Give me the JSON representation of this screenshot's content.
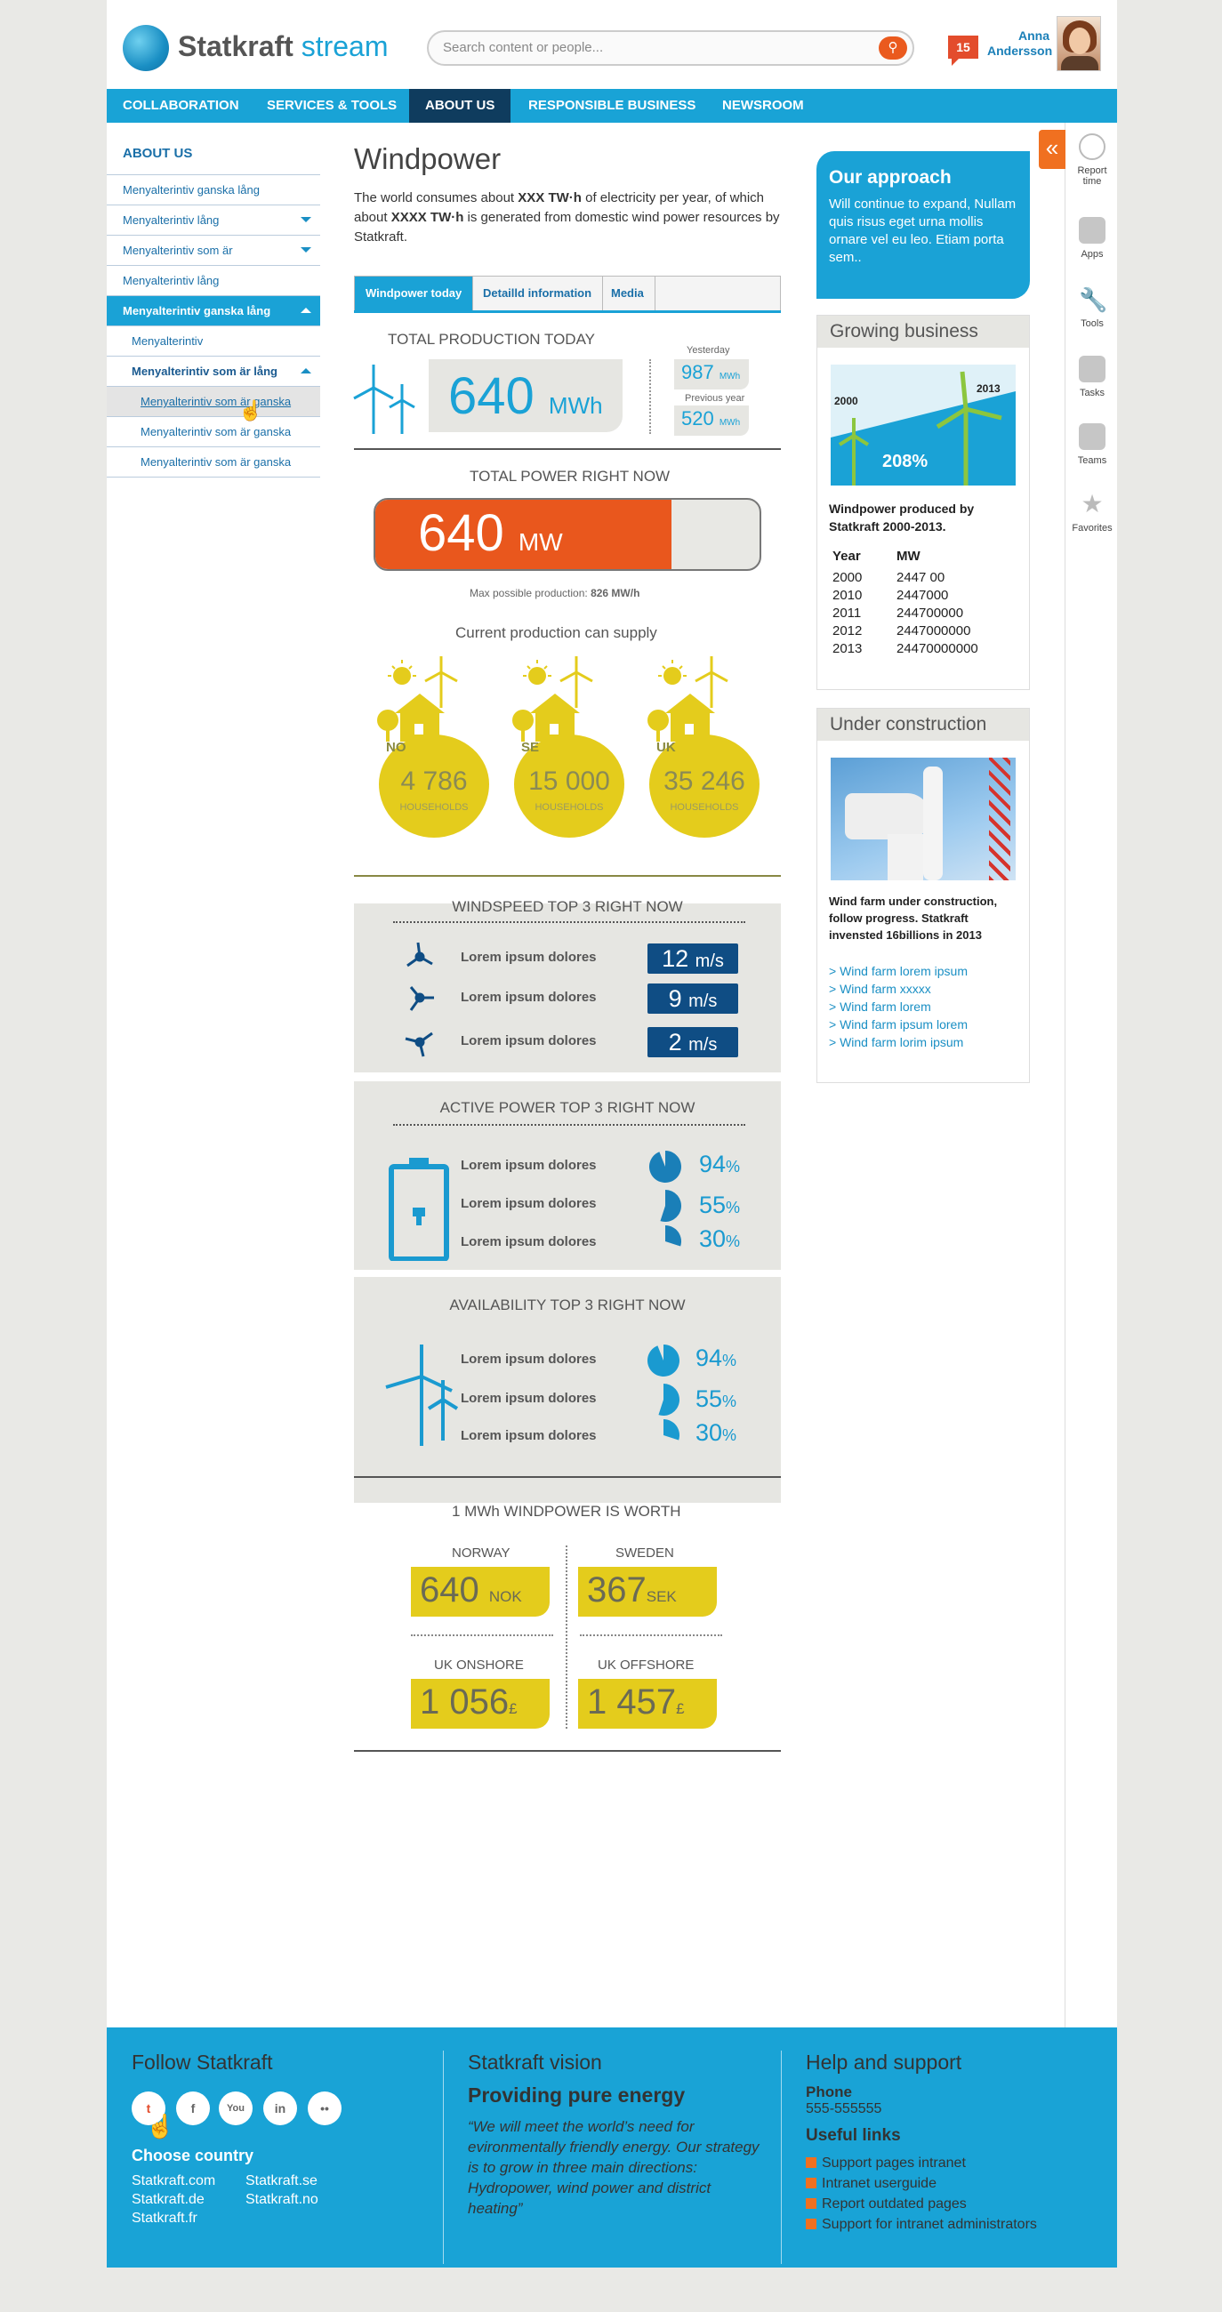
{
  "header": {
    "brand": "Statkraft",
    "brand_suffix": "stream",
    "search_placeholder": "Search content or people...",
    "notifications": "15",
    "user_first": "Anna",
    "user_last": "Andersson"
  },
  "nav": [
    "COLLABORATION",
    "SERVICES & TOOLS",
    "ABOUT US",
    "RESPONSIBLE BUSINESS",
    "NEWSROOM"
  ],
  "sidebar": {
    "title": "ABOUT US",
    "items": [
      "Menyalterintiv ganska lång",
      "Menyalterintiv  lång",
      "Menyalterintiv som är",
      "Menyalterintiv lång",
      "Menyalterintiv ganska lång",
      "Menyalterintiv",
      "Menyalterintiv som är lång",
      "Menyalterintiv som är ganska",
      "Menyalterintiv som är ganska",
      "Menyalterintiv som är ganska"
    ]
  },
  "righttools": [
    "Report time",
    "Apps",
    "Tools",
    "Tasks",
    "Teams",
    "Favorites"
  ],
  "main": {
    "title": "Windpower",
    "intro_1": "The world consumes about ",
    "intro_b1": "XXX TW·h",
    "intro_2": " of electricity per year, of which about ",
    "intro_b2": "XXXX TW·h",
    "intro_3": " is generated from domestic wind power resources by Statkraft.",
    "tabs": [
      "Windpower today",
      "Detailld information",
      "Media"
    ],
    "total_today": {
      "label": "TOTAL PRODUCTION TODAY",
      "value": "640",
      "unit": "MWh",
      "yesterday_label": "Yesterday",
      "yesterday_value": "987",
      "yesterday_unit": "MWh",
      "prev_label": "Previous year",
      "prev_value": "520",
      "prev_unit": "MWh"
    },
    "power_now": {
      "label": "TOTAL POWER RIGHT NOW",
      "value": "640",
      "unit": "MW",
      "fill_fraction": 0.77,
      "max_label": "Max possible production: ",
      "max_value": "826 MW/h"
    },
    "supply": {
      "label": "Current production can supply",
      "items": [
        {
          "cc": "NO",
          "value": "4 786",
          "unit": "HOUSEHOLDS"
        },
        {
          "cc": "SE",
          "value": "15 000",
          "unit": "HOUSEHOLDS"
        },
        {
          "cc": "UK",
          "value": "35 246",
          "unit": "HOUSEHOLDS"
        }
      ]
    },
    "windspeed": {
      "title": "WINDSPEED TOP 3 RIGHT NOW",
      "rows": [
        {
          "label": "Lorem ipsum dolores",
          "value": "12",
          "unit": "m/s"
        },
        {
          "label": "Lorem ipsum dolores",
          "value": "9",
          "unit": "m/s"
        },
        {
          "label": "Lorem ipsum dolores",
          "value": "2",
          "unit": "m/s"
        }
      ]
    },
    "active_power": {
      "title": "ACTIVE POWER TOP 3 RIGHT NOW",
      "rows": [
        {
          "label": "Lorem ipsum dolores",
          "value": "94",
          "unit": "%"
        },
        {
          "label": "Lorem ipsum dolores",
          "value": "55",
          "unit": "%"
        },
        {
          "label": "Lorem ipsum dolores",
          "value": "30",
          "unit": "%"
        }
      ]
    },
    "availability": {
      "title": "AVAILABILITY TOP 3 RIGHT NOW",
      "rows": [
        {
          "label": "Lorem ipsum dolores",
          "value": "94",
          "unit": "%"
        },
        {
          "label": "Lorem ipsum dolores",
          "value": "55",
          "unit": "%"
        },
        {
          "label": "Lorem ipsum dolores",
          "value": "30",
          "unit": "%"
        }
      ]
    },
    "worth": {
      "title": "1 MWh WINDPOWER IS WORTH",
      "items": [
        {
          "label": "NORWAY",
          "value": "640",
          "cur": "NOK"
        },
        {
          "label": "SWEDEN",
          "value": "367",
          "cur": "SEK"
        },
        {
          "label": "UK ONSHORE",
          "value": "1 056",
          "cur": "£"
        },
        {
          "label": "UK OFFSHORE",
          "value": "1 457",
          "cur": "£"
        }
      ]
    }
  },
  "right": {
    "approach_title": "Our approach",
    "approach_text": "Will continue to expand, Nullam quis risus eget urna mollis ornare vel eu leo. Etiam porta sem..",
    "growing_title": "Growing business",
    "growing_year_a": "2000",
    "growing_year_b": "2013",
    "growing_pct": "208%",
    "growing_caption": "Windpower produced by Statkraft 2000-2013.",
    "table_head": [
      "Year",
      "MW"
    ],
    "table_rows": [
      [
        "2000",
        "2447 00"
      ],
      [
        "2010",
        "2447000"
      ],
      [
        "2011",
        "244700000"
      ],
      [
        "2012",
        "2447000000"
      ],
      [
        "2013",
        "24470000000"
      ]
    ],
    "construction_title": "Under construction",
    "construction_caption": "Wind farm under construction, follow progress. Statkraft invensted 16billions in 2013",
    "links": [
      "> Wind farm lorem ipsum",
      "> Wind farm xxxxx",
      "> Wind farm lorem",
      "> Wind farm ipsum lorem",
      "> Wind farm lorim ipsum"
    ]
  },
  "footer": {
    "follow_title": "Follow Statkraft",
    "country_title": "Choose country",
    "countries": [
      "Statkraft.com",
      "Statkraft.se",
      "Statkraft.de",
      "Statkraft.no",
      "Statkraft.fr"
    ],
    "vision_title": "Statkraft vision",
    "vision_sub": "Providing pure energy",
    "vision_quote": "“We will meet the world’s need for evironmentally friendly energy. Our strategy is to grow in three main directions: Hydropower, wind power and district heating”",
    "help_title": "Help and support",
    "phone_label": "Phone",
    "phone": "555-555555",
    "links_label": "Useful links",
    "links": [
      "Support pages intranet",
      "Intranet userguide",
      "Report outdated pages",
      "Support for intranet administrators"
    ]
  },
  "colors": {
    "accent": "#19a3d6",
    "navy": "#0f3c5e",
    "orange": "#e9571d",
    "yellow": "#e4cc1c"
  }
}
